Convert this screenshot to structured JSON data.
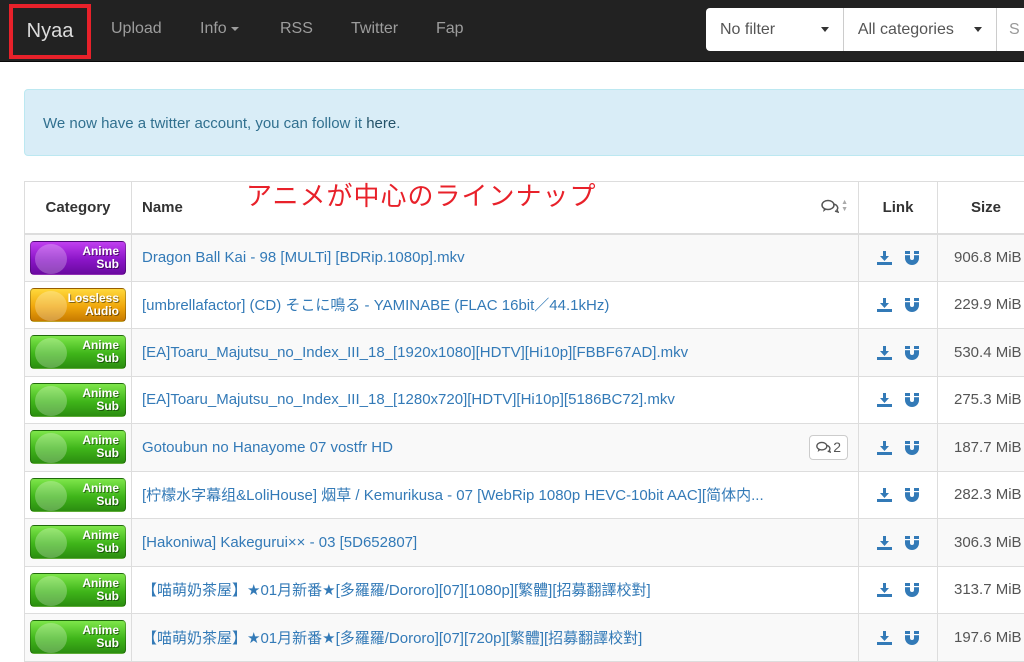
{
  "navbar": {
    "brand": "Nyaa",
    "links": [
      {
        "label": "Upload"
      },
      {
        "label": "Info",
        "dropdown": true
      },
      {
        "label": "RSS"
      },
      {
        "label": "Twitter"
      },
      {
        "label": "Fap"
      }
    ],
    "filter_select": "No filter",
    "category_select": "All categories",
    "search_stub": "S"
  },
  "alert": {
    "text_before": "We now have a twitter account, you can follow it ",
    "link": "here",
    "text_after": "."
  },
  "annotation": "アニメが中心のラインナップ",
  "table": {
    "headers": {
      "category": "Category",
      "name": "Name",
      "comments_icon": "comments-icon",
      "link": "Link",
      "size": "Size"
    },
    "rows": [
      {
        "category": "Anime Sub",
        "cat_line1": "Anime",
        "cat_line2": "Sub",
        "badge_color": "#8a15c7",
        "name": "Dragon Ball Kai - 98 [MULTi] [BDRip.1080p].mkv",
        "comments": null,
        "size": "906.8 MiB"
      },
      {
        "category": "Lossless Audio",
        "cat_line1": "Lossless",
        "cat_line2": "Audio",
        "badge_color": "#f0a70c",
        "name": "[umbrellafactor] (CD) そこに鳴る - YAMINABE (FLAC 16bit／44.1kHz)",
        "comments": null,
        "size": "229.9 MiB"
      },
      {
        "category": "Anime Sub",
        "cat_line1": "Anime",
        "cat_line2": "Sub",
        "badge_color": "#3fb51a",
        "name": "[EA]Toaru_Majutsu_no_Index_III_18_[1920x1080][HDTV][Hi10p][FBBF67AD].mkv",
        "comments": null,
        "size": "530.4 MiB"
      },
      {
        "category": "Anime Sub",
        "cat_line1": "Anime",
        "cat_line2": "Sub",
        "badge_color": "#3fb51a",
        "name": "[EA]Toaru_Majutsu_no_Index_III_18_[1280x720][HDTV][Hi10p][5186BC72].mkv",
        "comments": null,
        "size": "275.3 MiB"
      },
      {
        "category": "Anime Sub",
        "cat_line1": "Anime",
        "cat_line2": "Sub",
        "badge_color": "#3fb51a",
        "name": "Gotoubun no Hanayome 07 vostfr HD",
        "comments": "2",
        "size": "187.7 MiB"
      },
      {
        "category": "Anime Sub",
        "cat_line1": "Anime",
        "cat_line2": "Sub",
        "badge_color": "#3fb51a",
        "name": "[柠檬水字幕组&LoliHouse] 烟草 / Kemurikusa - 07 [WebRip 1080p HEVC-10bit AAC][简体内...",
        "comments": null,
        "size": "282.3 MiB"
      },
      {
        "category": "Anime Sub",
        "cat_line1": "Anime",
        "cat_line2": "Sub",
        "badge_color": "#3fb51a",
        "name": "[Hakoniwa] Kakegurui×× - 03 [5D652807]",
        "comments": null,
        "size": "306.3 MiB"
      },
      {
        "category": "Anime Sub",
        "cat_line1": "Anime",
        "cat_line2": "Sub",
        "badge_color": "#3fb51a",
        "name": "【喵萌奶茶屋】★01月新番★[多羅羅/Dororo][07][1080p][繁體][招募翻譯校對]",
        "comments": null,
        "size": "313.7 MiB"
      },
      {
        "category": "Anime Sub",
        "cat_line1": "Anime",
        "cat_line2": "Sub",
        "badge_color": "#3fb51a",
        "name": "【喵萌奶茶屋】★01月新番★[多羅羅/Dororo][07][720p][繁體][招募翻譯校對]",
        "comments": null,
        "size": "197.6 MiB"
      }
    ]
  },
  "colors": {
    "navbar_bg": "#222222",
    "brand_highlight": "#e8212a",
    "link_blue": "#337ab7",
    "alert_bg": "#d9edf7",
    "alert_text": "#31708f",
    "annotation_red": "#e8212a"
  }
}
